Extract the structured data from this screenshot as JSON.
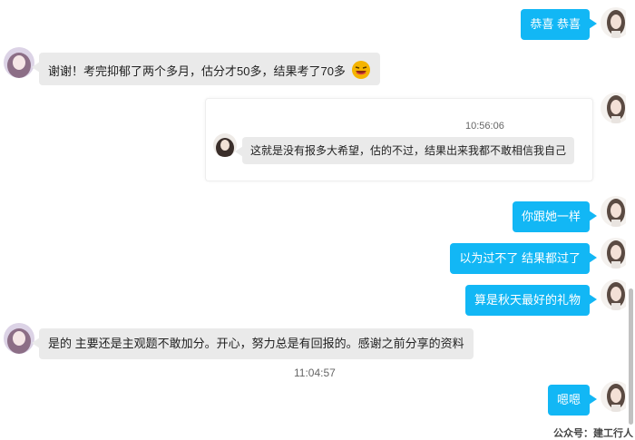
{
  "messages": [
    {
      "side": "right",
      "text": "恭喜 恭喜"
    },
    {
      "side": "left",
      "text": "谢谢！考完抑郁了两个多月，估分才50多，结果考了70多",
      "emoji": "laughing-face-icon"
    },
    {
      "side": "right",
      "type": "quote",
      "time": "10:56:06",
      "text": "这就是没有报多大希望，估的不过，结果出来我都不敢相信我自己"
    },
    {
      "side": "right",
      "text": "你跟她一样"
    },
    {
      "side": "right",
      "text": "以为过不了 结果都过了"
    },
    {
      "side": "right",
      "text": "算是秋天最好的礼物"
    },
    {
      "side": "left",
      "text": "是的 主要还是主观题不敢加分。开心，努力总是有回报的。感谢之前分享的资料"
    },
    {
      "type": "timestamp",
      "text": "11:04:57"
    },
    {
      "side": "right",
      "text": "嗯嗯"
    }
  ],
  "watermark": "公众号：建工行人",
  "colors": {
    "bubble_self": "#12b7f5",
    "bubble_other": "#eaeaea",
    "background": "#ffffff"
  }
}
